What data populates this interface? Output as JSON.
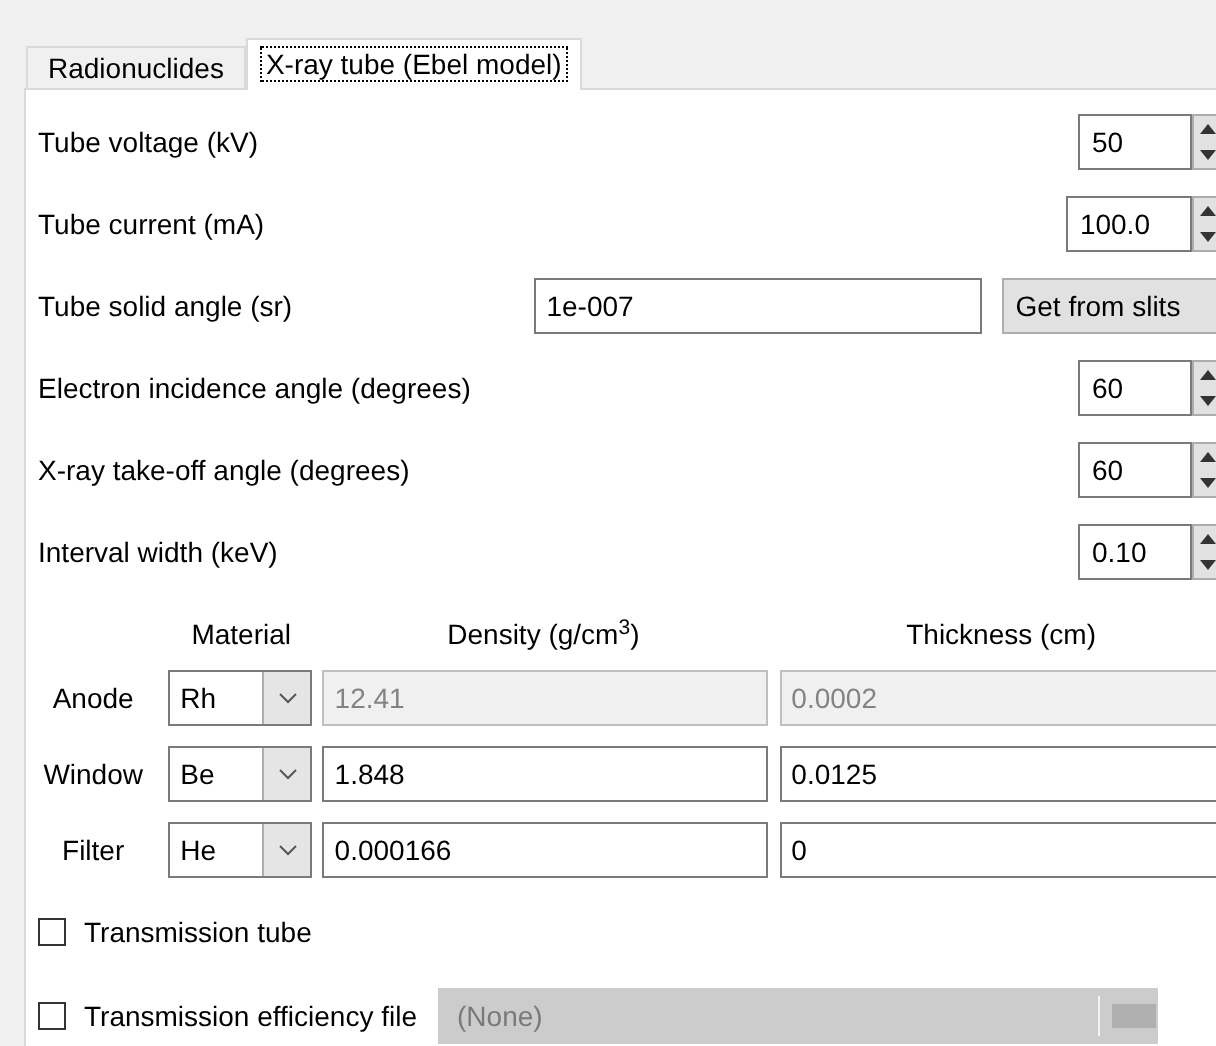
{
  "tabs": [
    {
      "label": "Radionuclides",
      "selected": false
    },
    {
      "label": "X-ray tube (Ebel model)",
      "selected": true
    }
  ],
  "parameters": [
    {
      "kind": "spinner",
      "label": "Tube voltage (kV)",
      "value": "50"
    },
    {
      "kind": "spinner",
      "label": "Tube current (mA)",
      "value": "100.0"
    },
    {
      "kind": "text_button",
      "label": "Tube solid angle (sr)",
      "value": "1e-007",
      "button": "Get from slits"
    },
    {
      "kind": "spinner",
      "label": "Electron incidence angle (degrees)",
      "value": "60"
    },
    {
      "kind": "spinner",
      "label": "X-ray take-off angle (degrees)",
      "value": "60"
    },
    {
      "kind": "spinner",
      "label": "Interval width (keV)",
      "value": "0.10"
    }
  ],
  "layers": {
    "columns": [
      "Material",
      "Density (g/cm$^{3}$)",
      "Thickness (cm)"
    ],
    "rows": [
      {
        "label": "Anode",
        "material": "Rh",
        "density": "12.41",
        "thickness": "0.0002",
        "disabled": true
      },
      {
        "label": "Window",
        "material": "Be",
        "density": "1.848",
        "thickness": "0.0125",
        "disabled": false
      },
      {
        "label": "Filter",
        "material": "He",
        "density": "0.000166",
        "thickness": "0",
        "disabled": false
      }
    ]
  },
  "options": [
    {
      "kind": "checkbox",
      "label": "Transmission tube",
      "checked": false
    },
    {
      "kind": "file",
      "label": "Transmission efficiency file",
      "checked": false,
      "value": "(None)",
      "disabled": true
    }
  ]
}
